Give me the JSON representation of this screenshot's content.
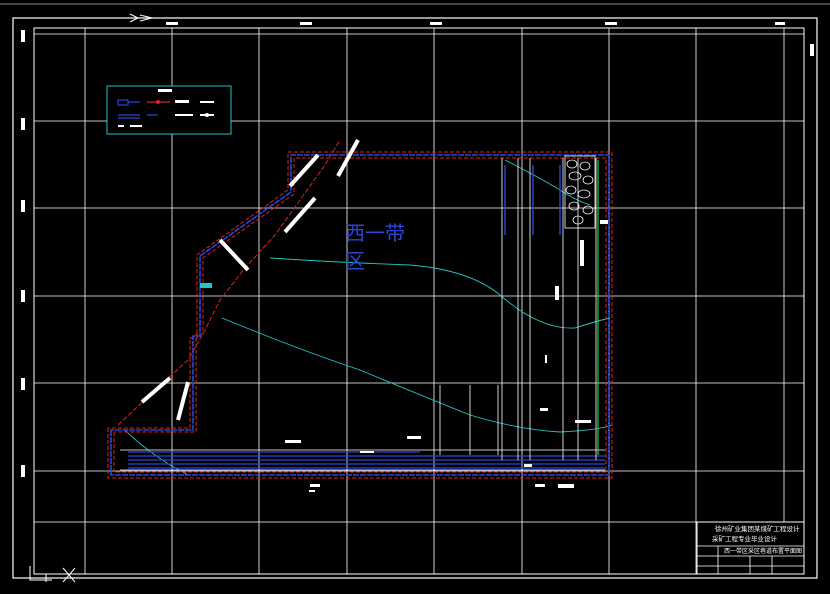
{
  "drawing": {
    "region_label_line1": "西一带",
    "region_label_line2": "区"
  },
  "title_block": {
    "line1": "徐州矿业集团某煤矿工程设计",
    "line2": "采矿工程专业毕业设计",
    "line3": "西一带区采区巷道布置平面图"
  },
  "colors": {
    "background": "#000000",
    "grid": "#ffffff",
    "roadway_blue": "#2b46d8",
    "boundary_red": "#e0201e",
    "contour_cyan": "#22c4c8",
    "legend_border": "#22c4c8",
    "accent_green": "#1fd04a"
  }
}
